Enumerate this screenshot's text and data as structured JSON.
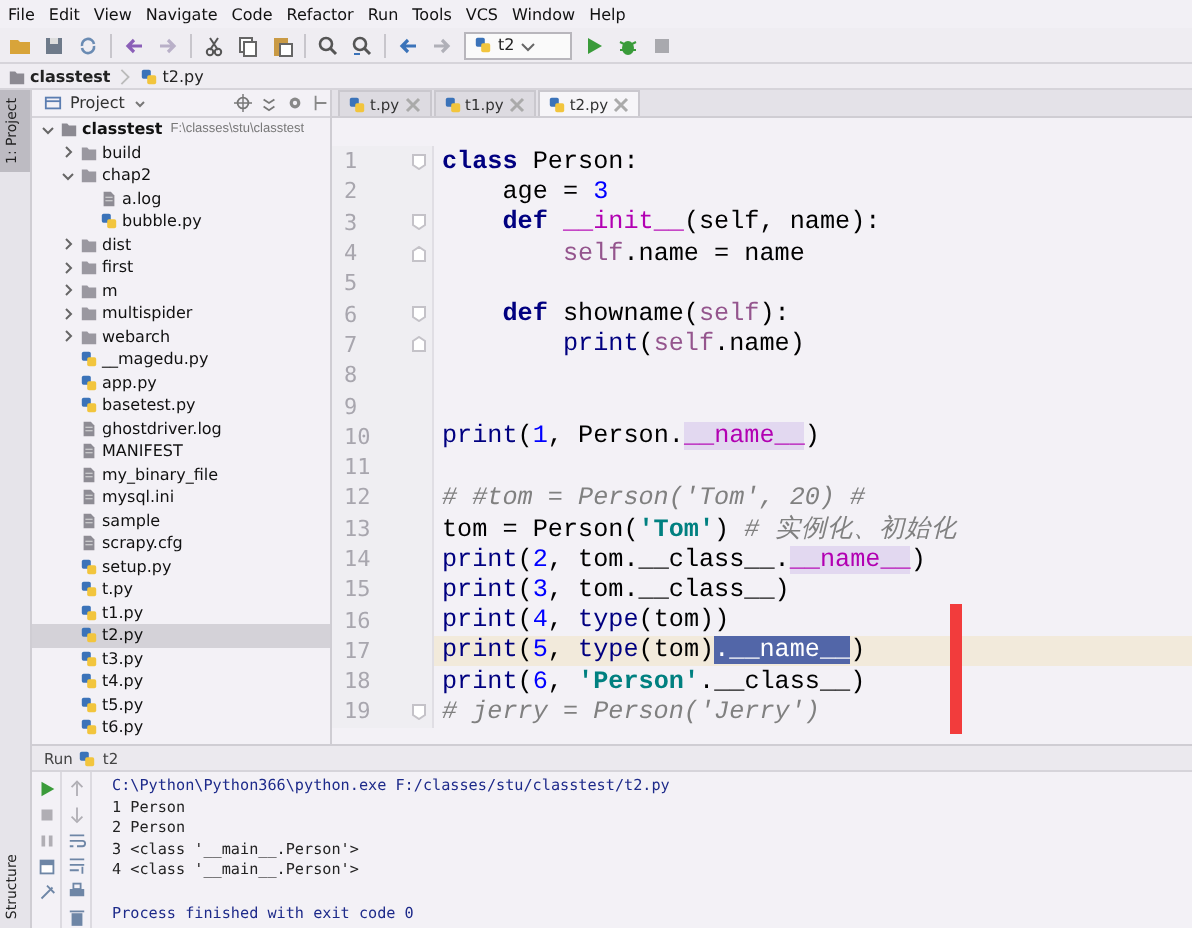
{
  "menu": [
    "File",
    "Edit",
    "View",
    "Navigate",
    "Code",
    "Refactor",
    "Run",
    "Tools",
    "VCS",
    "Window",
    "Help"
  ],
  "toolbar": {
    "run_config": "t2"
  },
  "breadcrumb": [
    "classtest",
    "t2.py"
  ],
  "side_tabs": [
    {
      "label": "1: Project",
      "selected": true
    },
    {
      "label": "Structure",
      "selected": false
    }
  ],
  "project": {
    "title": "Project",
    "tree": [
      {
        "name": "classtest",
        "path": "F:\\classes\\stu\\classtest",
        "kind": "root",
        "expanded": true,
        "selected": false,
        "children": [
          {
            "name": "build",
            "kind": "folder",
            "expanded": false,
            "selected": false
          },
          {
            "name": "chap2",
            "kind": "folder",
            "expanded": true,
            "selected": false,
            "children": [
              {
                "name": "a.log",
                "kind": "text",
                "selected": false
              },
              {
                "name": "bubble.py",
                "kind": "python",
                "selected": false
              }
            ]
          },
          {
            "name": "dist",
            "kind": "folder",
            "expanded": false,
            "selected": false
          },
          {
            "name": "first",
            "kind": "folder",
            "expanded": false,
            "selected": false
          },
          {
            "name": "m",
            "kind": "folder",
            "expanded": false,
            "selected": false
          },
          {
            "name": "multispider",
            "kind": "folder",
            "expanded": false,
            "selected": false
          },
          {
            "name": "webarch",
            "kind": "folder",
            "expanded": false,
            "selected": false
          },
          {
            "name": "__magedu.py",
            "kind": "python",
            "selected": false
          },
          {
            "name": "app.py",
            "kind": "python",
            "selected": false
          },
          {
            "name": "basetest.py",
            "kind": "python",
            "selected": false
          },
          {
            "name": "ghostdriver.log",
            "kind": "text",
            "selected": false
          },
          {
            "name": "MANIFEST",
            "kind": "text",
            "selected": false
          },
          {
            "name": "my_binary_file",
            "kind": "text",
            "selected": false
          },
          {
            "name": "mysql.ini",
            "kind": "text",
            "selected": false
          },
          {
            "name": "sample",
            "kind": "text",
            "selected": false
          },
          {
            "name": "scrapy.cfg",
            "kind": "text",
            "selected": false
          },
          {
            "name": "setup.py",
            "kind": "python",
            "selected": false
          },
          {
            "name": "t.py",
            "kind": "python",
            "selected": false
          },
          {
            "name": "t1.py",
            "kind": "python",
            "selected": false
          },
          {
            "name": "t2.py",
            "kind": "python",
            "selected": true
          },
          {
            "name": "t3.py",
            "kind": "python",
            "selected": false
          },
          {
            "name": "t4.py",
            "kind": "python",
            "selected": false
          },
          {
            "name": "t5.py",
            "kind": "python",
            "selected": false
          },
          {
            "name": "t6.py",
            "kind": "python",
            "selected": false
          }
        ]
      }
    ]
  },
  "editor": {
    "tabs": [
      {
        "label": "t.py",
        "selected": false
      },
      {
        "label": "t1.py",
        "selected": false
      },
      {
        "label": "t2.py",
        "selected": true
      }
    ],
    "lines": [
      {
        "number": "1",
        "fold_start": true,
        "current": false,
        "tokens": [
          {
            "kind": "keyword",
            "text": "class"
          },
          {
            "kind": "plain",
            "text": " Person:"
          }
        ]
      },
      {
        "number": "2",
        "current": false,
        "tokens": [
          {
            "kind": "plain",
            "text": "    age = "
          },
          {
            "kind": "number",
            "text": "3"
          }
        ]
      },
      {
        "number": "3",
        "fold_start": true,
        "current": false,
        "tokens": [
          {
            "kind": "keyword",
            "text": "    def "
          },
          {
            "kind": "dunder",
            "text": "__init__"
          },
          {
            "kind": "plain",
            "text": "(self, name):"
          }
        ]
      },
      {
        "number": "4",
        "fold_end": true,
        "current": false,
        "tokens": [
          {
            "kind": "self",
            "text": "        self"
          },
          {
            "kind": "plain",
            "text": ".name = name"
          }
        ]
      },
      {
        "number": "5",
        "current": false
      },
      {
        "number": "6",
        "fold_start": true,
        "current": false,
        "tokens": [
          {
            "kind": "keyword",
            "text": "    def"
          },
          {
            "kind": "plain",
            "text": " showname("
          },
          {
            "kind": "self",
            "text": "self"
          },
          {
            "kind": "plain",
            "text": "):"
          }
        ]
      },
      {
        "number": "7",
        "fold_end": true,
        "current": false,
        "tokens": [
          {
            "kind": "builtin",
            "text": "        print"
          },
          {
            "kind": "plain",
            "text": "("
          },
          {
            "kind": "self",
            "text": "self"
          },
          {
            "kind": "plain",
            "text": ".name)"
          }
        ]
      },
      {
        "number": "8",
        "current": false
      },
      {
        "number": "9",
        "current": false
      },
      {
        "number": "10",
        "current": false,
        "tokens": [
          {
            "kind": "builtin",
            "text": "print"
          },
          {
            "kind": "plain",
            "text": "("
          },
          {
            "kind": "number",
            "text": "1"
          },
          {
            "kind": "plain",
            "text": ", Person."
          },
          {
            "kind": "occurrence",
            "text": "__name__"
          },
          {
            "kind": "plain",
            "text": ")"
          }
        ]
      },
      {
        "number": "11",
        "current": false
      },
      {
        "number": "12",
        "current": false,
        "tokens": [
          {
            "kind": "comment",
            "text": "# #tom = Person('Tom', 20) #"
          }
        ]
      },
      {
        "number": "13",
        "current": false,
        "tokens": [
          {
            "kind": "plain",
            "text": "tom = Person("
          },
          {
            "kind": "string",
            "text": "'Tom'"
          },
          {
            "kind": "plain",
            "text": ") "
          },
          {
            "kind": "comment",
            "text": "# 实例化、初始化"
          }
        ]
      },
      {
        "number": "14",
        "current": false,
        "tokens": [
          {
            "kind": "builtin",
            "text": "print"
          },
          {
            "kind": "plain",
            "text": "("
          },
          {
            "kind": "number",
            "text": "2"
          },
          {
            "kind": "plain",
            "text": ", tom.__class__."
          },
          {
            "kind": "occurrence",
            "text": "__name__"
          },
          {
            "kind": "plain",
            "text": ")"
          }
        ]
      },
      {
        "number": "15",
        "current": false,
        "tokens": [
          {
            "kind": "builtin",
            "text": "print"
          },
          {
            "kind": "plain",
            "text": "("
          },
          {
            "kind": "number",
            "text": "3"
          },
          {
            "kind": "plain",
            "text": ", tom.__class__)"
          }
        ]
      },
      {
        "number": "16",
        "current": false,
        "tokens": [
          {
            "kind": "builtin",
            "text": "print"
          },
          {
            "kind": "plain",
            "text": "("
          },
          {
            "kind": "number",
            "text": "4"
          },
          {
            "kind": "plain",
            "text": ", "
          },
          {
            "kind": "builtin",
            "text": "type"
          },
          {
            "kind": "plain",
            "text": "(tom))"
          }
        ]
      },
      {
        "number": "17",
        "current": true,
        "tokens": [
          {
            "kind": "builtin",
            "text": "print"
          },
          {
            "kind": "plain",
            "text": "("
          },
          {
            "kind": "number",
            "text": "5"
          },
          {
            "kind": "plain",
            "text": ", "
          },
          {
            "kind": "builtin",
            "text": "type"
          },
          {
            "kind": "plain",
            "text": "(tom)"
          },
          {
            "kind": "selection",
            "text": ".__name__"
          },
          {
            "kind": "plain",
            "text": ")"
          }
        ]
      },
      {
        "number": "18",
        "current": false,
        "tokens": [
          {
            "kind": "builtin",
            "text": "print"
          },
          {
            "kind": "plain",
            "text": "("
          },
          {
            "kind": "number",
            "text": "6"
          },
          {
            "kind": "plain",
            "text": ", "
          },
          {
            "kind": "string",
            "text": "'Person'"
          },
          {
            "kind": "plain",
            "text": ".__class__)"
          }
        ]
      },
      {
        "number": "19",
        "fold_start": true,
        "current": false,
        "tokens": [
          {
            "kind": "comment",
            "text": "# jerry = Person('Jerry')"
          }
        ]
      }
    ]
  },
  "run": {
    "title": "Run",
    "config": "t2",
    "output": [
      {
        "kind": "command",
        "text": "C:\\Python\\Python366\\python.exe F:/classes/stu/classtest/t2.py"
      },
      {
        "kind": "stdout",
        "text": "1 Person"
      },
      {
        "kind": "stdout",
        "text": "2 Person"
      },
      {
        "kind": "stdout",
        "text": "3 <class '__main__.Person'>"
      },
      {
        "kind": "stdout",
        "text": "4 <class '__main__.Person'>"
      },
      {
        "kind": "blank"
      },
      {
        "kind": "status",
        "text": "Process finished with exit code 0"
      }
    ]
  }
}
